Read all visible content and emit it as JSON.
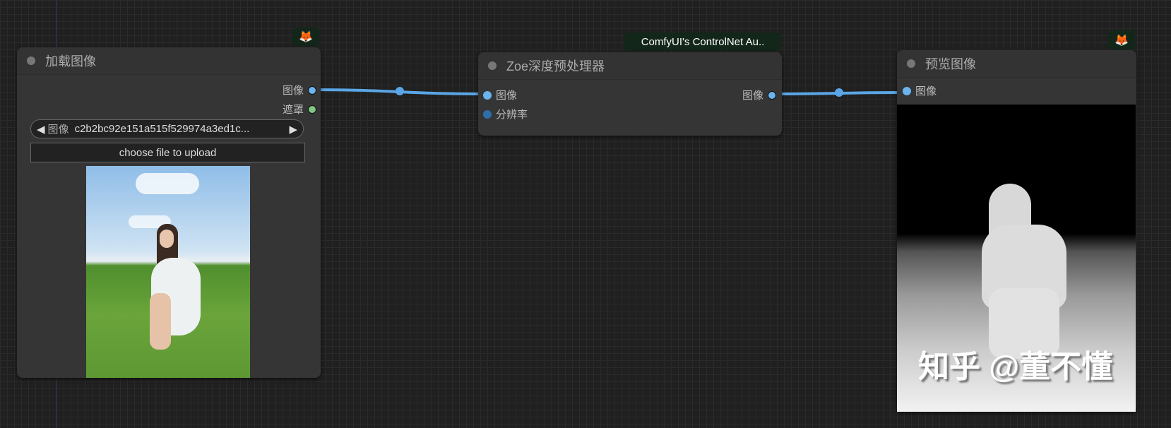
{
  "colors": {
    "image_port": "#6ab4f0",
    "mask_port": "#81c784",
    "link": "#5aa6e6",
    "resolution_port": "#2f6ea8"
  },
  "load_node": {
    "title": "加载图像",
    "badge_icon": "fox-icon",
    "outputs": [
      "图像",
      "遮罩"
    ],
    "combo_label": "图像",
    "combo_value": "c2b2bc92e151a515f529974a3ed1c...",
    "upload_label": "choose file to upload"
  },
  "zoe_node": {
    "title": "Zoe深度预处理器",
    "badge": "ComfyUI's ControlNet Au..",
    "inputs": [
      "图像",
      "分辨率"
    ],
    "outputs": [
      "图像"
    ]
  },
  "preview_node": {
    "title": "预览图像",
    "badge_icon": "fox-icon",
    "inputs": [
      "图像"
    ],
    "watermark": "知乎 @董不懂"
  }
}
